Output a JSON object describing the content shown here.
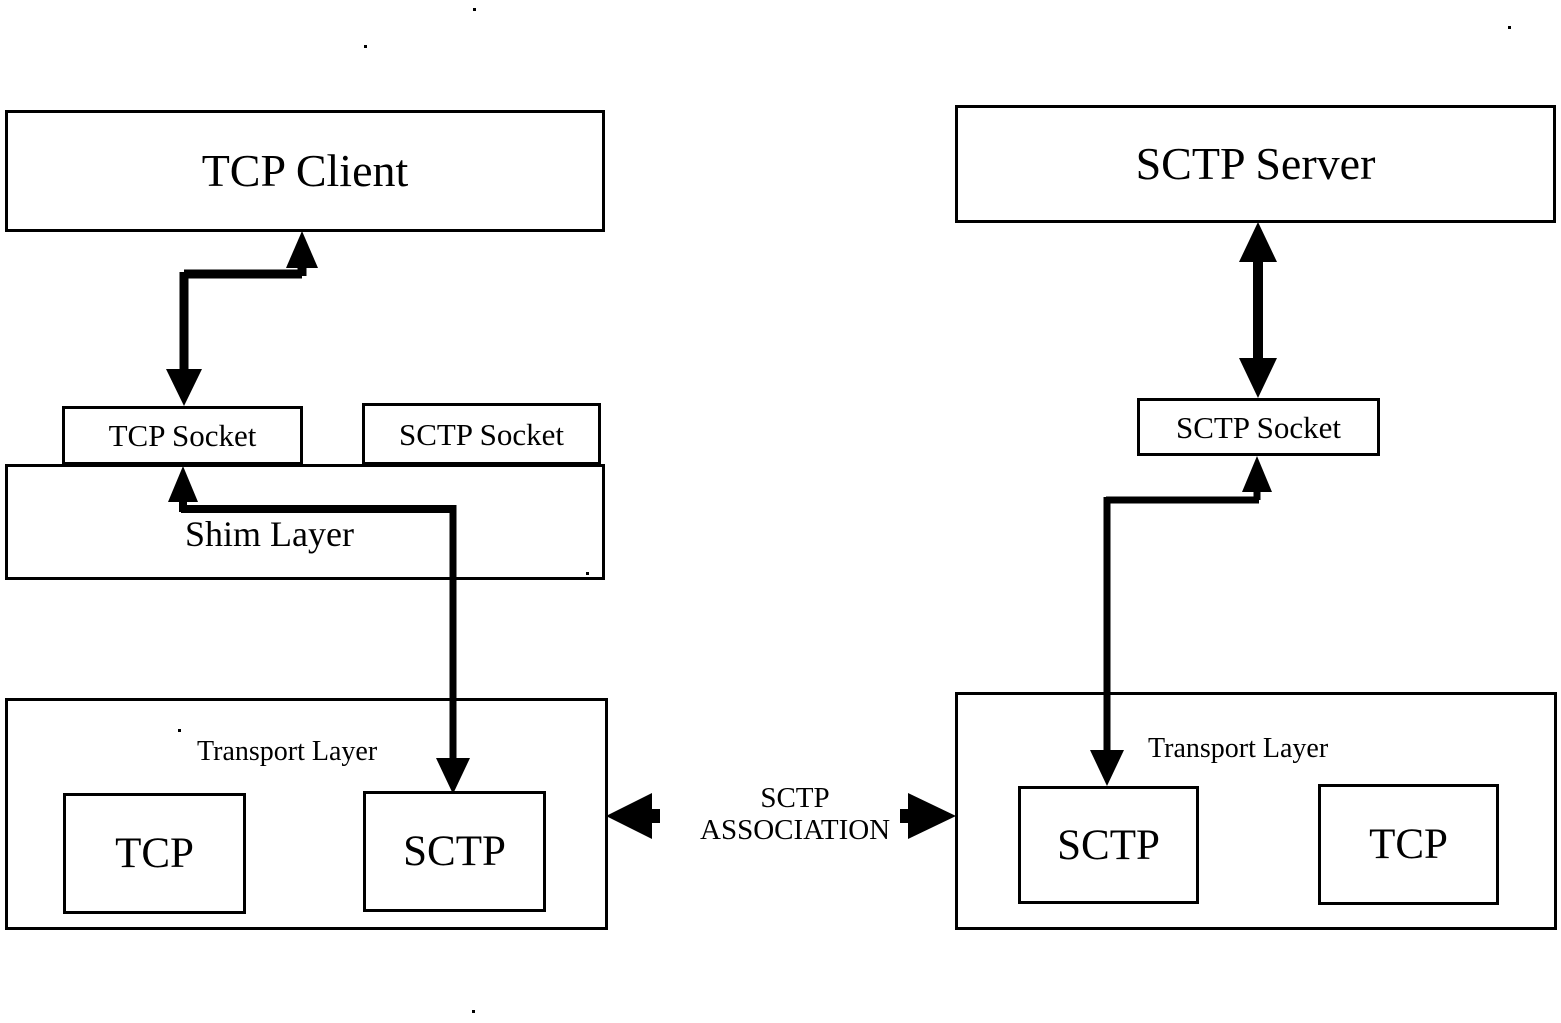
{
  "diagram": {
    "title": "SCTP shim layer architecture between TCP client and SCTP server",
    "ink_color": "#000000",
    "background_color": "#ffffff",
    "left_stack": {
      "application": "TCP Client",
      "sockets": [
        {
          "label": "TCP Socket"
        },
        {
          "label": "SCTP Socket"
        }
      ],
      "shim": "Shim Layer",
      "transport": {
        "label": "Transport Layer",
        "protocols": [
          {
            "label": "TCP"
          },
          {
            "label": "SCTP"
          }
        ]
      }
    },
    "right_stack": {
      "application": "SCTP Server",
      "sockets": [
        {
          "label": "SCTP Socket"
        }
      ],
      "transport": {
        "label": "Transport Layer",
        "protocols": [
          {
            "label": "SCTP"
          },
          {
            "label": "TCP"
          }
        ]
      }
    },
    "link": {
      "line1": "SCTP",
      "line2": "ASSOCIATION"
    }
  }
}
